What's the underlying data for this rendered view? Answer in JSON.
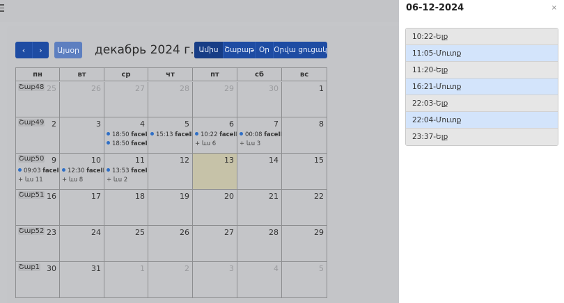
{
  "toolbar": {
    "prev_icon": "chevron-left-icon",
    "next_icon": "chevron-right-icon",
    "prev_glyph": "‹",
    "next_glyph": "›",
    "today_label": "Այսօր",
    "title": "декабрь 2024 г.",
    "views": [
      "Ամիս",
      "Շաբաթ",
      "Օր",
      "Օրվա ցուցակ"
    ],
    "active_view": "Ամիս"
  },
  "calendar": {
    "weekdays": [
      "пн",
      "вт",
      "ср",
      "чт",
      "пт",
      "сб",
      "вс"
    ],
    "weeks": [
      {
        "label": "Շաբ48",
        "days": [
          {
            "n": "25",
            "other": true
          },
          {
            "n": "26",
            "other": true
          },
          {
            "n": "27",
            "other": true
          },
          {
            "n": "28",
            "other": true
          },
          {
            "n": "29",
            "other": true
          },
          {
            "n": "30",
            "other": true
          },
          {
            "n": "1"
          }
        ]
      },
      {
        "label": "Շաբ49",
        "days": [
          {
            "n": "2"
          },
          {
            "n": "3"
          },
          {
            "n": "4",
            "events": [
              {
                "time": "18:50",
                "title": "faceID"
              },
              {
                "time": "18:50",
                "title": "faceID"
              }
            ]
          },
          {
            "n": "5",
            "events": [
              {
                "time": "15:13",
                "title": "faceID"
              }
            ]
          },
          {
            "n": "6",
            "events": [
              {
                "time": "10:22",
                "title": "faceID"
              }
            ],
            "more": "+ ևս 6"
          },
          {
            "n": "7",
            "events": [
              {
                "time": "00:08",
                "title": "faceID"
              }
            ],
            "more": "+ ևս 3"
          },
          {
            "n": "8"
          }
        ]
      },
      {
        "label": "Շաբ50",
        "days": [
          {
            "n": "9",
            "events": [
              {
                "time": "09:03",
                "title": "faceID"
              }
            ],
            "more": "+ ևս 11"
          },
          {
            "n": "10",
            "events": [
              {
                "time": "12:30",
                "title": "faceID"
              }
            ],
            "more": "+ ևս 8"
          },
          {
            "n": "11",
            "events": [
              {
                "time": "13:53",
                "title": "faceID"
              }
            ],
            "more": "+ ևս 2"
          },
          {
            "n": "12"
          },
          {
            "n": "13",
            "today": true
          },
          {
            "n": "14"
          },
          {
            "n": "15"
          }
        ]
      },
      {
        "label": "Շաբ51",
        "days": [
          {
            "n": "16"
          },
          {
            "n": "17"
          },
          {
            "n": "18"
          },
          {
            "n": "19"
          },
          {
            "n": "20"
          },
          {
            "n": "21"
          },
          {
            "n": "22"
          }
        ]
      },
      {
        "label": "Շաբ52",
        "days": [
          {
            "n": "23"
          },
          {
            "n": "24"
          },
          {
            "n": "25"
          },
          {
            "n": "26"
          },
          {
            "n": "27"
          },
          {
            "n": "28"
          },
          {
            "n": "29"
          }
        ]
      },
      {
        "label": "Շաբ1",
        "days": [
          {
            "n": "30"
          },
          {
            "n": "31"
          },
          {
            "n": "1",
            "other": true
          },
          {
            "n": "2",
            "other": true
          },
          {
            "n": "3",
            "other": true
          },
          {
            "n": "4",
            "other": true
          },
          {
            "n": "5",
            "other": true
          }
        ]
      }
    ]
  },
  "panel": {
    "title": "06-12-2024",
    "close_icon": "close-icon",
    "close_glyph": "×",
    "items": [
      {
        "label": "10:22-Ելք",
        "kind": "exit"
      },
      {
        "label": "11:05-Մուտք",
        "kind": "entry"
      },
      {
        "label": "11:20-Ելք",
        "kind": "exit"
      },
      {
        "label": "16:21-Մուտք",
        "kind": "entry"
      },
      {
        "label": "22:03-Ելք",
        "kind": "exit"
      },
      {
        "label": "22:04-Մուտք",
        "kind": "entry"
      },
      {
        "label": "23:37-Ելք",
        "kind": "exit"
      }
    ]
  },
  "colors": {
    "primary": "#1e4ca3",
    "entry_bg": "#d3e4fb",
    "exit_bg": "#e6e6e6",
    "today_bg": "#c6c2a8",
    "event_dot": "#2f6fc6"
  }
}
